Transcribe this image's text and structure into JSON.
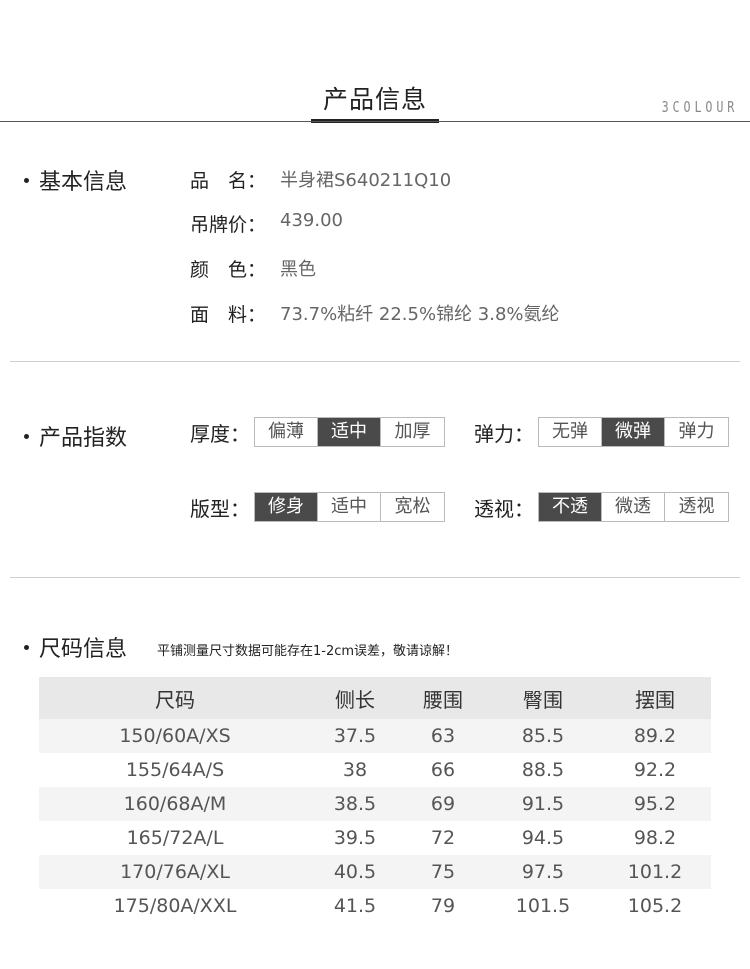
{
  "header": {
    "title": "产品信息",
    "brand": "3COLOUR"
  },
  "basic_info": {
    "title": "基本信息",
    "rows": [
      {
        "label": "品　名：",
        "value": "半身裙S640211Q10"
      },
      {
        "label": "吊牌价：",
        "value": "439.00"
      },
      {
        "label": "颜　色：",
        "value": "黑色"
      },
      {
        "label": "面　料：",
        "value": "73.7%粘纤 22.5%锦纶 3.8%氨纶"
      }
    ]
  },
  "product_index": {
    "title": "产品指数",
    "attributes": [
      {
        "label": "厚度：",
        "options": [
          "偏薄",
          "适中",
          "加厚"
        ],
        "selected": 1
      },
      {
        "label": "弹力：",
        "options": [
          "无弹",
          "微弹",
          "弹力"
        ],
        "selected": 1
      },
      {
        "label": "版型：",
        "options": [
          "修身",
          "适中",
          "宽松"
        ],
        "selected": 0
      },
      {
        "label": "透视：",
        "options": [
          "不透",
          "微透",
          "透视"
        ],
        "selected": 0
      }
    ],
    "active_color": "#4a4a4a"
  },
  "size_info": {
    "title": "尺码信息",
    "note": "平铺测量尺寸数据可能存在1-2cm误差，敬请谅解！",
    "headers": [
      "尺码",
      "侧长",
      "腰围",
      "臀围",
      "摆围"
    ],
    "rows": [
      [
        "150/60A/XS",
        "37.5",
        "63",
        "85.5",
        "89.2"
      ],
      [
        "155/64A/S",
        "38",
        "66",
        "88.5",
        "92.2"
      ],
      [
        "160/68A/M",
        "38.5",
        "69",
        "91.5",
        "95.2"
      ],
      [
        "165/72A/L",
        "39.5",
        "72",
        "94.5",
        "98.2"
      ],
      [
        "170/76A/XL",
        "40.5",
        "75",
        "97.5",
        "101.2"
      ],
      [
        "175/80A/XXL",
        "41.5",
        "79",
        "101.5",
        "105.2"
      ]
    ]
  }
}
